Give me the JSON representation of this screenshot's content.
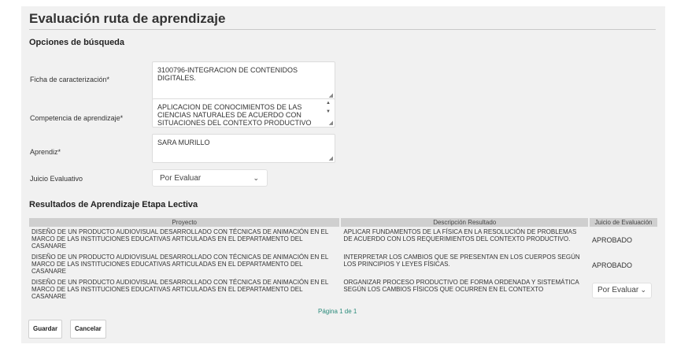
{
  "page": {
    "title": "Evaluación ruta de aprendizaje"
  },
  "search": {
    "section_title": "Opciones de búsqueda",
    "ficha_label": "Ficha de caracterización*",
    "ficha_value": "3100796-INTEGRACION DE CONTENIDOS DIGITALES.",
    "competencia_label": "Competencia de aprendizaje*",
    "competencia_value": "APLICACION DE CONOCIMIENTOS DE LAS CIENCIAS NATURALES DE ACUERDO CON SITUACIONES DEL CONTEXTO PRODUCTIVO",
    "aprendiz_label": "Aprendiz*",
    "aprendiz_value": "SARA MURILLO",
    "juicio_label": "Juicio Evaluativo",
    "juicio_selected": "Por Evaluar"
  },
  "results": {
    "section_title": "Resultados de Aprendizaje Etapa Lectiva",
    "columns": [
      "Proyecto",
      "Descripción Resultado",
      "Juicio de Evaluación"
    ],
    "rows": [
      {
        "proyecto": "DISEÑO DE UN PRODUCTO AUDIOVISUAL DESARROLLADO CON TÉCNICAS DE ANIMACIÓN EN EL MARCO DE LAS INSTITUCIONES EDUCATIVAS ARTICULADAS EN EL DEPARTAMENTO DEL CASANARE",
        "descripcion": "APLICAR FUNDAMENTOS DE LA FÍSICA EN LA RESOLUCIÓN DE PROBLEMAS DE ACUERDO CON LOS REQUERIMIENTOS DEL CONTEXTO PRODUCTIVO.",
        "juicio": "APROBADO"
      },
      {
        "proyecto": "DISEÑO DE UN PRODUCTO AUDIOVISUAL DESARROLLADO CON TÉCNICAS DE ANIMACIÓN EN EL MARCO DE LAS INSTITUCIONES EDUCATIVAS ARTICULADAS EN EL DEPARTAMENTO DEL CASANARE",
        "descripcion": "INTERPRETAR LOS CAMBIOS QUE SE PRESENTAN EN LOS CUERPOS SEGÚN LOS PRINCIPIOS Y LEYES FÍSICAS.",
        "juicio": "APROBADO"
      },
      {
        "proyecto": "DISEÑO DE UN PRODUCTO AUDIOVISUAL DESARROLLADO CON TÉCNICAS DE ANIMACIÓN EN EL MARCO DE LAS INSTITUCIONES EDUCATIVAS ARTICULADAS EN EL DEPARTAMENTO DEL CASANARE",
        "descripcion": "ORGANIZAR PROCESO PRODUCTIVO DE FORMA ORDENADA Y SISTEMÁTICA SEGÚN LOS CAMBIOS FÍSICOS QUE OCURREN EN EL CONTEXTO",
        "juicio_selected": "Por Evaluar"
      }
    ],
    "pager": "Página 1 de 1"
  },
  "actions": {
    "save_label": "Guardar",
    "cancel_label": "Cancelar"
  },
  "icons": {
    "dropdown": "chevron-down-icon",
    "resize": "resize-grip-icon",
    "scroll": "scroll-arrows-icon"
  },
  "colors": {
    "background": "#f1f1f1",
    "table_header": "#cfcfcf",
    "pager_text": "#2a8a7a"
  }
}
